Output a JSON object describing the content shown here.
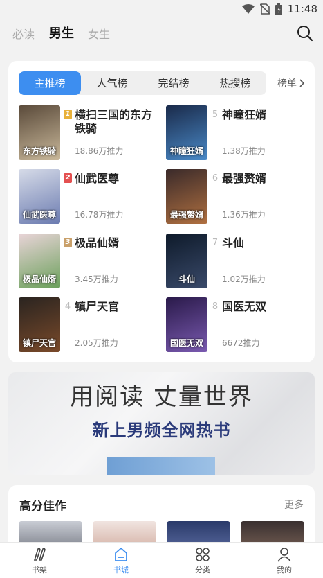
{
  "status_bar": {
    "time": "11:48",
    "icons": [
      "wifi-icon",
      "no-sim-icon",
      "battery-icon"
    ]
  },
  "header": {
    "tabs": [
      {
        "label": "必读",
        "active": false
      },
      {
        "label": "男生",
        "active": true
      },
      {
        "label": "女生",
        "active": false
      }
    ],
    "search_icon": "search-icon"
  },
  "ranking": {
    "tabs": [
      {
        "label": "主推榜",
        "active": true
      },
      {
        "label": "人气榜",
        "active": false
      },
      {
        "label": "完结榜",
        "active": false
      },
      {
        "label": "热搜榜",
        "active": false
      }
    ],
    "more_label": "榜单",
    "books": [
      {
        "rank": "1",
        "title": "横扫三国的东方铁骑",
        "stat": "18.86万推力",
        "cover_text": "东方铁骑",
        "badge_color": "#e8b13a",
        "cover_colors": [
          "#5a4a3a",
          "#c9b89a"
        ]
      },
      {
        "rank": "2",
        "title": "仙武医尊",
        "stat": "16.78万推力",
        "cover_text": "仙武医尊",
        "badge_color": "#e45050",
        "cover_colors": [
          "#d6dbe8",
          "#6b7bb0"
        ]
      },
      {
        "rank": "3",
        "title": "极品仙婿",
        "stat": "3.45万推力",
        "cover_text": "极品仙婿",
        "badge_color": "#c9a06a",
        "cover_colors": [
          "#e9d4d8",
          "#6aa05a"
        ]
      },
      {
        "rank": "4",
        "title": "镇尸天官",
        "stat": "2.05万推力",
        "cover_text": "镇尸天官",
        "badge_color": "",
        "cover_colors": [
          "#2a2420",
          "#7a4a2a"
        ]
      },
      {
        "rank": "5",
        "title": "神瞳狂婿",
        "stat": "1.38万推力",
        "cover_text": "神瞳狂婿",
        "badge_color": "",
        "cover_colors": [
          "#1a2a4a",
          "#4a8ac8"
        ]
      },
      {
        "rank": "6",
        "title": "最强赘婿",
        "stat": "1.36万推力",
        "cover_text": "最强赘婿",
        "badge_color": "",
        "cover_colors": [
          "#3a2a2a",
          "#b07040"
        ]
      },
      {
        "rank": "7",
        "title": "斗仙",
        "stat": "1.02万推力",
        "cover_text": "斗仙",
        "badge_color": "",
        "cover_colors": [
          "#0e1a2a",
          "#3a4a6a"
        ]
      },
      {
        "rank": "8",
        "title": "国医无双",
        "stat": "6672推力",
        "cover_text": "国医无双",
        "badge_color": "",
        "cover_colors": [
          "#2a1a4a",
          "#7a5ab0"
        ]
      }
    ]
  },
  "banner": {
    "line1": "用阅读 丈量世界",
    "line2": "新上男频全网热书"
  },
  "high_score": {
    "title": "高分佳作",
    "more": "更多"
  },
  "bottom_nav": [
    {
      "label": "书架",
      "icon": "bookshelf-icon",
      "active": false
    },
    {
      "label": "书城",
      "icon": "bookstore-icon",
      "active": true
    },
    {
      "label": "分类",
      "icon": "category-icon",
      "active": false
    },
    {
      "label": "我的",
      "icon": "profile-icon",
      "active": false
    }
  ],
  "colors": {
    "accent": "#3d8ef0",
    "background": "#f2f2f2"
  }
}
